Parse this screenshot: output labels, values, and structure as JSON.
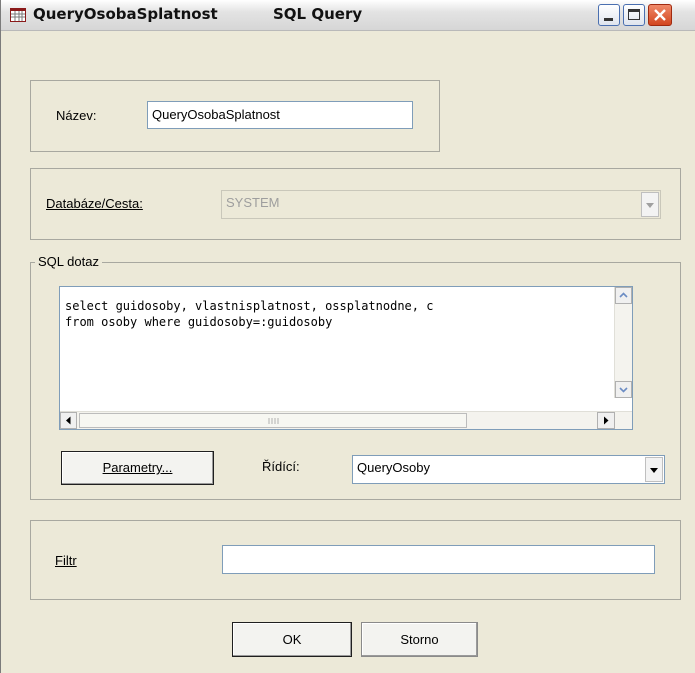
{
  "window": {
    "title_name": "QueryOsobaSplatnost",
    "title_type": "SQL Query"
  },
  "name_group": {
    "label": "Název:",
    "value": "QueryOsobaSplatnost"
  },
  "database_group": {
    "label": "Databáze/Cesta:",
    "value": "SYSTEM"
  },
  "sql_group": {
    "label": "SQL dotaz",
    "lines": [
      "select guidosoby, vlastnisplatnost, ossplatnodne, c",
      "from osoby where guidosoby=:guidosoby"
    ],
    "parameters_button": "Parametry...",
    "master_label": "Řídící:",
    "master_value": "QueryOsoby"
  },
  "filter_group": {
    "label": "Filtr",
    "value": ""
  },
  "footer": {
    "ok_label": "OK",
    "cancel_label": "Storno"
  },
  "colors": {
    "dialog_bg": "#ece9d8",
    "close_button": "#d2461f"
  },
  "icons": [
    "app-icon",
    "minimize-icon",
    "maximize-icon",
    "close-icon",
    "scroll-up-icon",
    "scroll-down-icon",
    "scroll-left-icon",
    "scroll-right-icon",
    "dropdown-arrow-icon"
  ]
}
